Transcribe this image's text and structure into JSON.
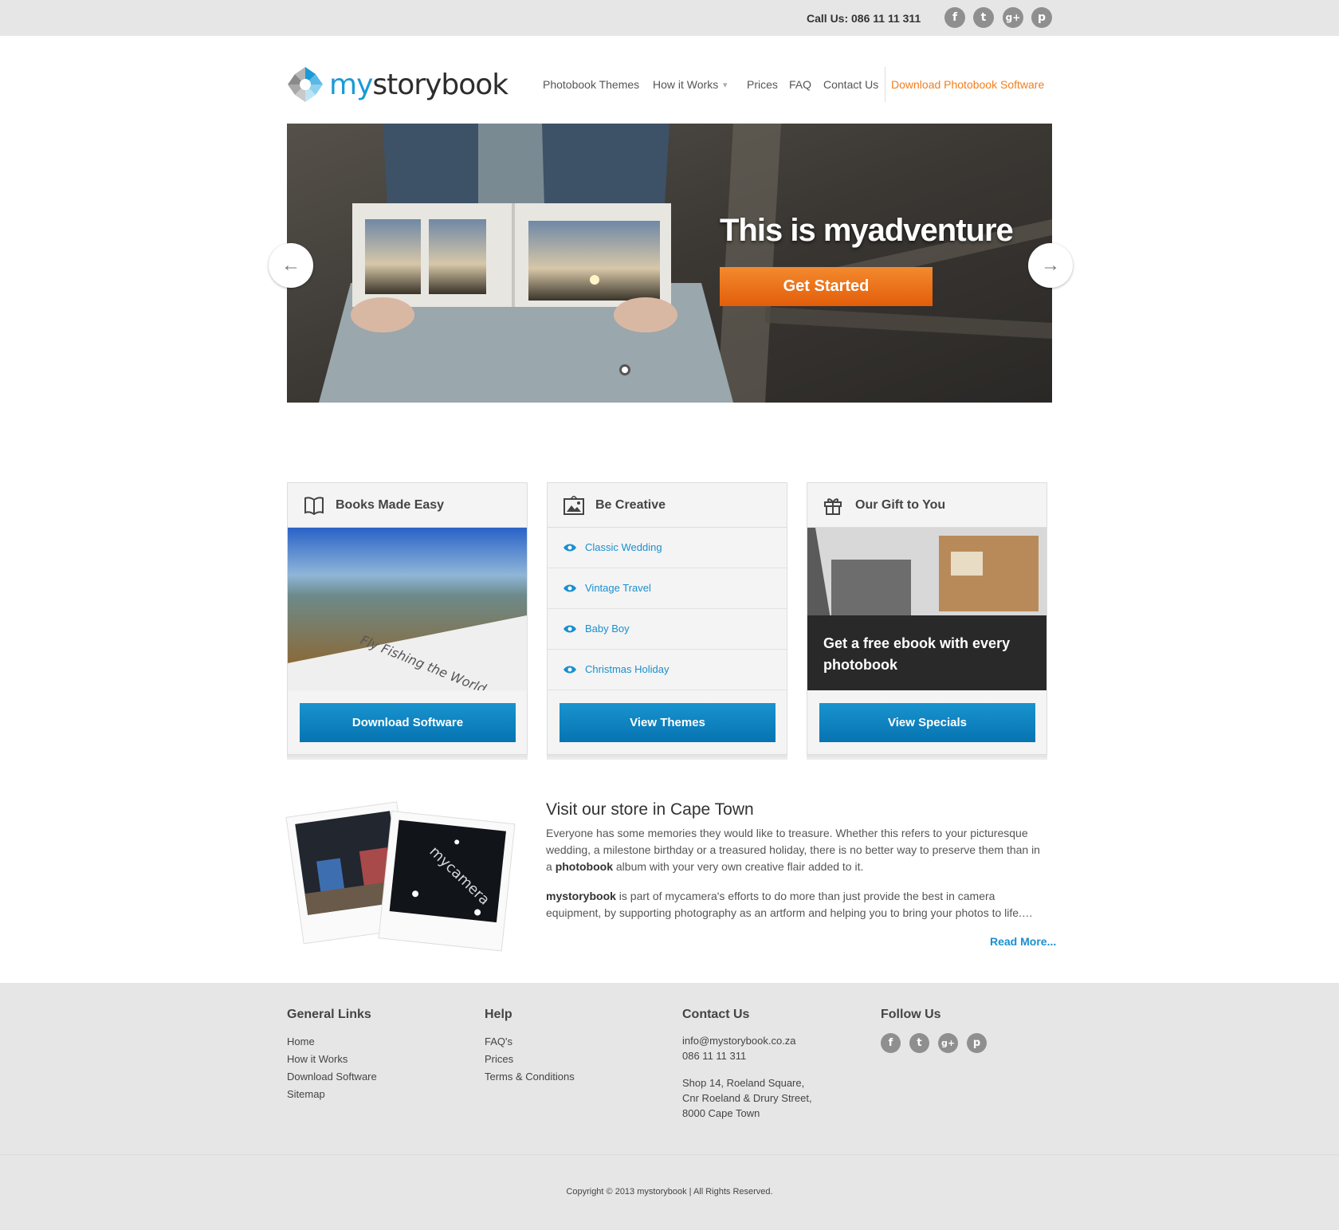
{
  "topbar": {
    "call_us": "Call Us: 086 11 11 311",
    "social": [
      "f",
      "t",
      "g+",
      "p"
    ]
  },
  "logo": {
    "part1": "my",
    "part2": "storybook"
  },
  "nav": {
    "items": [
      "Photobook Themes",
      "How it Works",
      "Prices",
      "FAQ",
      "Contact Us"
    ],
    "download": "Download Photobook Software",
    "dropdown_arrow": "▾"
  },
  "hero": {
    "title": "This is myadventure",
    "button": "Get Started",
    "prev": "←",
    "next": "→"
  },
  "cards": {
    "books": {
      "title": "Books Made Easy",
      "image_caption": "Fly Fishing the World",
      "button": "Download Software"
    },
    "creative": {
      "title": "Be Creative",
      "themes": [
        "Classic Wedding",
        "Vintage Travel",
        "Baby Boy",
        "Christmas Holiday"
      ],
      "button": "View Themes"
    },
    "gift": {
      "title": "Our Gift to You",
      "caption": "Get a free ebook with every photobook",
      "button": "View Specials"
    }
  },
  "store": {
    "heading": "Visit our store in Cape Town",
    "p1_a": "Everyone has some memories they would like to treasure. Whether this refers to your picturesque wedding, a milestone birthday or a treasured holiday, there is no better way to preserve them than in a ",
    "p1_bold": "photobook",
    "p1_b": " album with your very own creative flair added to it.",
    "p2_bold": "mystorybook",
    "p2_rest": " is part of mycamera's efforts to do more than just provide the best in camera equipment, by supporting photography as an artform and helping you to bring your photos to life.…",
    "read_more": "Read More...",
    "sign": "mycamera"
  },
  "footer": {
    "general": {
      "title": "General Links",
      "links": [
        "Home",
        "How it Works",
        "Download Software",
        "Sitemap"
      ]
    },
    "help": {
      "title": "Help",
      "links": [
        "FAQ's",
        "Prices",
        "Terms & Conditions"
      ]
    },
    "contact": {
      "title": "Contact Us",
      "email": "info@mystorybook.co.za",
      "phone": "086 11 11 311",
      "address": [
        "Shop 14, Roeland Square,",
        "Cnr Roeland & Drury Street,",
        "8000 Cape Town"
      ]
    },
    "follow": {
      "title": "Follow Us"
    },
    "copyright": "Copyright © 2013 mystorybook | All Rights Reserved."
  },
  "colors": {
    "accent_blue": "#1a8fcf",
    "accent_orange": "#f07f1e",
    "button_blue": "#0a7dbd"
  }
}
